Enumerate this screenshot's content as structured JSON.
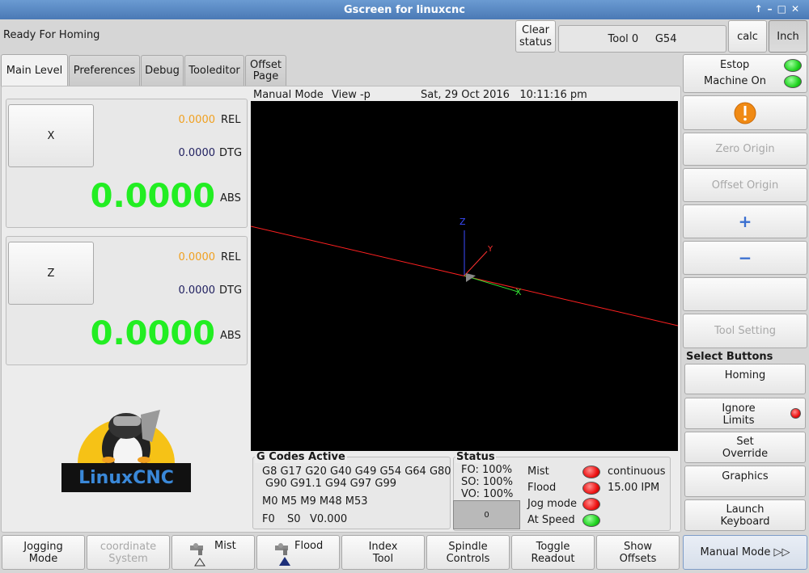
{
  "window": {
    "title": "Gscreen for linuxcnc",
    "controls": [
      "↑",
      "–",
      "□",
      "✕"
    ]
  },
  "header": {
    "status_message": "Ready For Homing",
    "clear_status": [
      "Clear",
      "status"
    ],
    "tool_info": "Tool 0     G54",
    "calc_label": "calc",
    "inch_label": "Inch"
  },
  "tabs": [
    {
      "label": "Main Level"
    },
    {
      "label": "Preferences"
    },
    {
      "label": "Debug"
    },
    {
      "label": "Tooleditor"
    },
    {
      "label_lines": [
        "Offset",
        "Page"
      ]
    }
  ],
  "axes": [
    {
      "name": "X",
      "rel_value": "0.0000",
      "rel_label": "REL",
      "dtg_value": "0.0000",
      "dtg_label": "DTG",
      "abs_value": "0.0000",
      "abs_label": "ABS"
    },
    {
      "name": "Z",
      "rel_value": "0.0000",
      "rel_label": "REL",
      "dtg_value": "0.0000",
      "dtg_label": "DTG",
      "abs_value": "0.0000",
      "abs_label": "ABS"
    }
  ],
  "logo": {
    "text": "LinuxCNC"
  },
  "graphics": {
    "mode": "Manual Mode",
    "view": "View -p",
    "datetime": "Sat, 29 Oct 2016   10:11:16 pm",
    "axis_labels": [
      "Z",
      "Y",
      "X"
    ]
  },
  "gcodes": {
    "title": "G Codes Active",
    "line1": "G8 G17 G20 G40 G49 G54 G64 G80",
    "line2": "G90 G91.1 G94 G97 G99",
    "mcodes": "M0 M5 M9 M48 M53",
    "feed": "F0",
    "speed": "S0",
    "velocity": "V0.000"
  },
  "status": {
    "title": "Status",
    "fo": "FO: 100%",
    "so": "SO: 100%",
    "vo": "VO: 100%",
    "spin_value": "0",
    "indicators": [
      {
        "label": "Mist",
        "state": "red"
      },
      {
        "label": "Flood",
        "state": "red"
      },
      {
        "label": "Jog mode",
        "state": "red"
      },
      {
        "label": "At Speed",
        "state": "green"
      }
    ],
    "jog_type": "continuous",
    "jog_rate": "15.00 IPM"
  },
  "right_panel": {
    "estop_label": "Estop",
    "machine_on_label": "Machine On",
    "zero_origin": "Zero Origin",
    "offset_origin": "Offset Origin",
    "plus": "+",
    "minus": "−",
    "tool_setting": "Tool Setting",
    "select_buttons_title": "Select Buttons",
    "homing": "Homing",
    "ignore_limits": [
      "Ignore",
      "Limits"
    ],
    "set_override": [
      "Set",
      "Override"
    ],
    "graphics": "Graphics",
    "launch_keyboard": [
      "Launch",
      "Keyboard"
    ]
  },
  "bottom_bar": {
    "jogging_mode": [
      "Jogging",
      "Mode"
    ],
    "coordinate_system": [
      "coordinate",
      "System"
    ],
    "mist": "Mist",
    "flood": "Flood",
    "index_tool": [
      "Index",
      "Tool"
    ],
    "spindle_controls": [
      "Spindle",
      "Controls"
    ],
    "toggle_readout": [
      "Toggle",
      "Readout"
    ],
    "show_offsets": [
      "Show",
      "Offsets"
    ],
    "manual_mode": "Manual Mode ▷▷"
  },
  "colors": {
    "rel": "#f0a020",
    "dtg": "#202060",
    "abs": "#22ee22",
    "titlebar": "#5a88c4"
  }
}
